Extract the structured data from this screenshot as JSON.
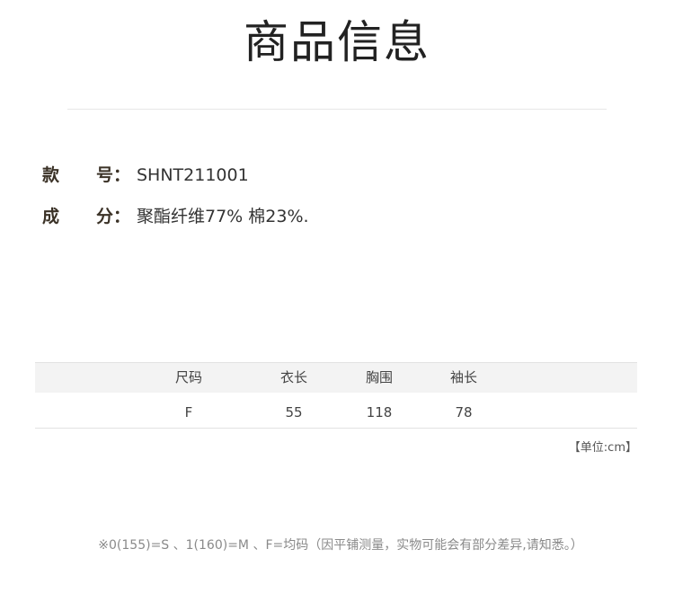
{
  "page": {
    "title": "商品信息"
  },
  "specs": [
    {
      "label_a": "款",
      "label_b": "号：",
      "value": "SHNT211001"
    },
    {
      "label_a": "成",
      "label_b": "分：",
      "value": "聚酯纤维77% 棉23%."
    }
  ],
  "size_table": {
    "headers": [
      "尺码",
      "衣长",
      "胸围",
      "袖长"
    ],
    "rows": [
      [
        "F",
        "55",
        "118",
        "78"
      ]
    ],
    "unit": "【单位:cm】"
  },
  "note": "※0(155)=S 、1(160)=M 、F=均码（因平铺测量，实物可能会有部分差异,请知悉。）",
  "theme": {
    "bg": "#ffffff",
    "title": "#222222",
    "divider": "#e6e6e6",
    "label": "#3a3126",
    "value": "#333333",
    "head-bg": "#f3f3f3",
    "border": "#e2e2e2",
    "cell": "#444444",
    "unit": "#555555",
    "note": "#8a8a8a"
  }
}
